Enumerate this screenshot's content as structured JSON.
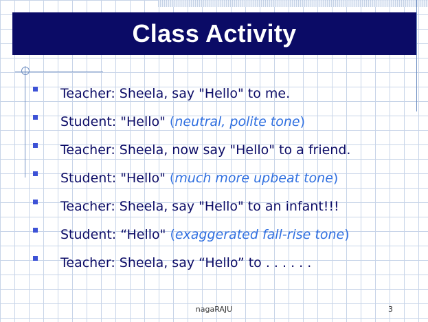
{
  "slide": {
    "title": "Class Activity",
    "bullets": [
      {
        "text": "Teacher: Sheela, say \"Hello\" to me.",
        "pre": "",
        "italic": "",
        "post": ""
      },
      {
        "text": "Student: \"Hello\" ",
        "pre": "(",
        "italic": "neutral, polite tone",
        "post": ")"
      },
      {
        "text": "Teacher: Sheela, now say \"Hello\" to a friend.",
        "pre": "",
        "italic": "",
        "post": ""
      },
      {
        "text": "Student: \"Hello\" ",
        "pre": "(",
        "italic": "much more upbeat tone",
        "post": ")"
      },
      {
        "text": "Teacher: Sheela, say \"Hello\" to an infant!!!",
        "pre": "",
        "italic": "",
        "post": ""
      },
      {
        "text": "Student: “Hello\" ",
        "pre": "(",
        "italic": "exaggerated fall-rise tone",
        "post": ")"
      },
      {
        "text": "Teacher: Sheela, say “Hello” to . . . . . .",
        "pre": "",
        "italic": "",
        "post": ""
      }
    ],
    "footer": {
      "author": "nagaRAJU",
      "page_number": "3"
    },
    "colors": {
      "title_bar": "#0b0b66",
      "body_text": "#0b0b66",
      "italic_note": "#2f6fe0",
      "bullet": "#3d52d6",
      "grid": "#c7d4e8"
    }
  }
}
